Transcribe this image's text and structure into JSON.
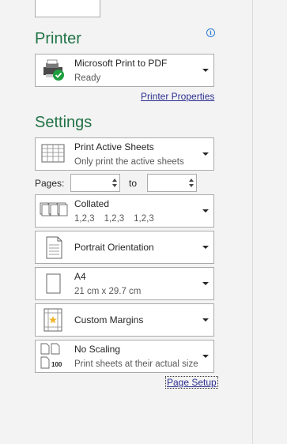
{
  "printer": {
    "heading": "Printer",
    "name": "Microsoft Print to PDF",
    "status": "Ready",
    "properties_link": "Printer Properties",
    "info_icon": "info-icon"
  },
  "settings": {
    "heading": "Settings",
    "print_what": {
      "title": "Print Active Sheets",
      "subtitle": "Only print the active sheets"
    },
    "pages": {
      "label": "Pages:",
      "from_value": "",
      "to_label": "to",
      "to_value": ""
    },
    "collation": {
      "title": "Collated",
      "nums": [
        "1,2,3",
        "1,2,3",
        "1,2,3"
      ]
    },
    "orientation": {
      "title": "Portrait Orientation"
    },
    "paper": {
      "title": "A4",
      "subtitle": "21 cm x 29.7 cm"
    },
    "margins": {
      "title": "Custom Margins"
    },
    "scaling": {
      "title": "No Scaling",
      "subtitle": "Print sheets at their actual size",
      "icon_label": "100"
    },
    "page_setup_link": "Page Setup"
  },
  "colors": {
    "heading": "#217346",
    "link": "#2e3192",
    "ready_check": "#1e9e3e"
  }
}
